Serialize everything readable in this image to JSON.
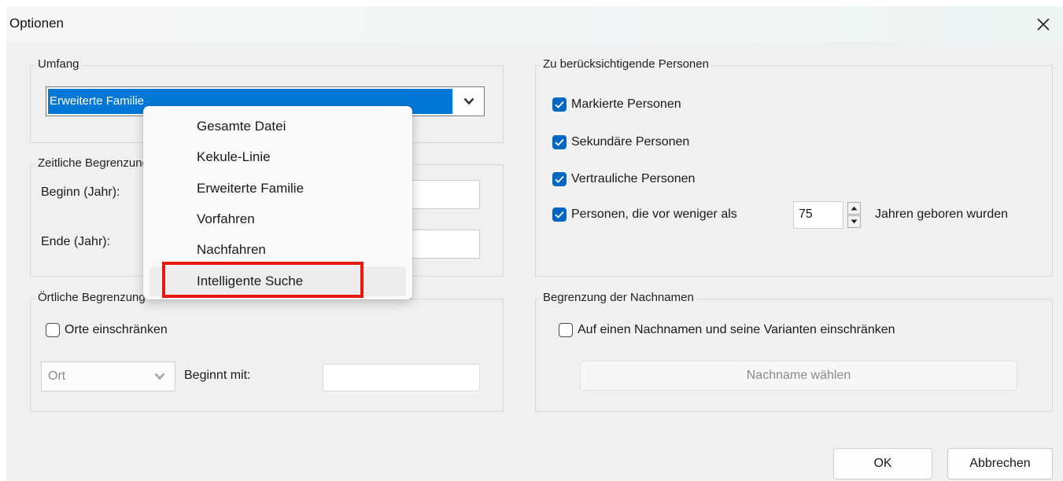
{
  "window": {
    "title": "Optionen"
  },
  "scope": {
    "group_title": "Umfang",
    "selected": "Erweiterte Familie",
    "options": [
      "Gesamte Datei",
      "Kekule-Linie",
      "Erweiterte Familie",
      "Vorfahren",
      "Nachfahren",
      "Intelligente Suche"
    ],
    "highlighted_option": "Intelligente Suche"
  },
  "time_limit": {
    "group_title": "Zeitliche Begrenzung",
    "start_label": "Beginn (Jahr):",
    "start_value": "",
    "end_label": "Ende (Jahr):",
    "end_value": ""
  },
  "place_limit": {
    "group_title": "Örtliche Begrenzung",
    "restrict_label": "Orte einschränken",
    "restrict_checked": false,
    "place_select": "Ort",
    "starts_with_label": "Beginnt mit:",
    "starts_with_value": ""
  },
  "persons": {
    "group_title": "Zu berücksichtigende Personen",
    "items": [
      {
        "label": "Markierte Personen",
        "checked": true
      },
      {
        "label": "Sekundäre Personen",
        "checked": true
      },
      {
        "label": "Vertrauliche Personen",
        "checked": true
      },
      {
        "label": "Personen, die vor weniger als",
        "checked": true
      }
    ],
    "years_value": "75",
    "years_suffix": "Jahren geboren wurden"
  },
  "surname_limit": {
    "group_title": "Begrenzung der Nachnamen",
    "restrict_label": "Auf einen Nachnamen und seine Varianten einschränken",
    "restrict_checked": false,
    "choose_button": "Nachname wählen"
  },
  "buttons": {
    "ok": "OK",
    "cancel": "Abbrechen"
  },
  "colors": {
    "accent": "#0067c0",
    "selection": "#0078d7",
    "highlight_border": "#e8190f"
  }
}
